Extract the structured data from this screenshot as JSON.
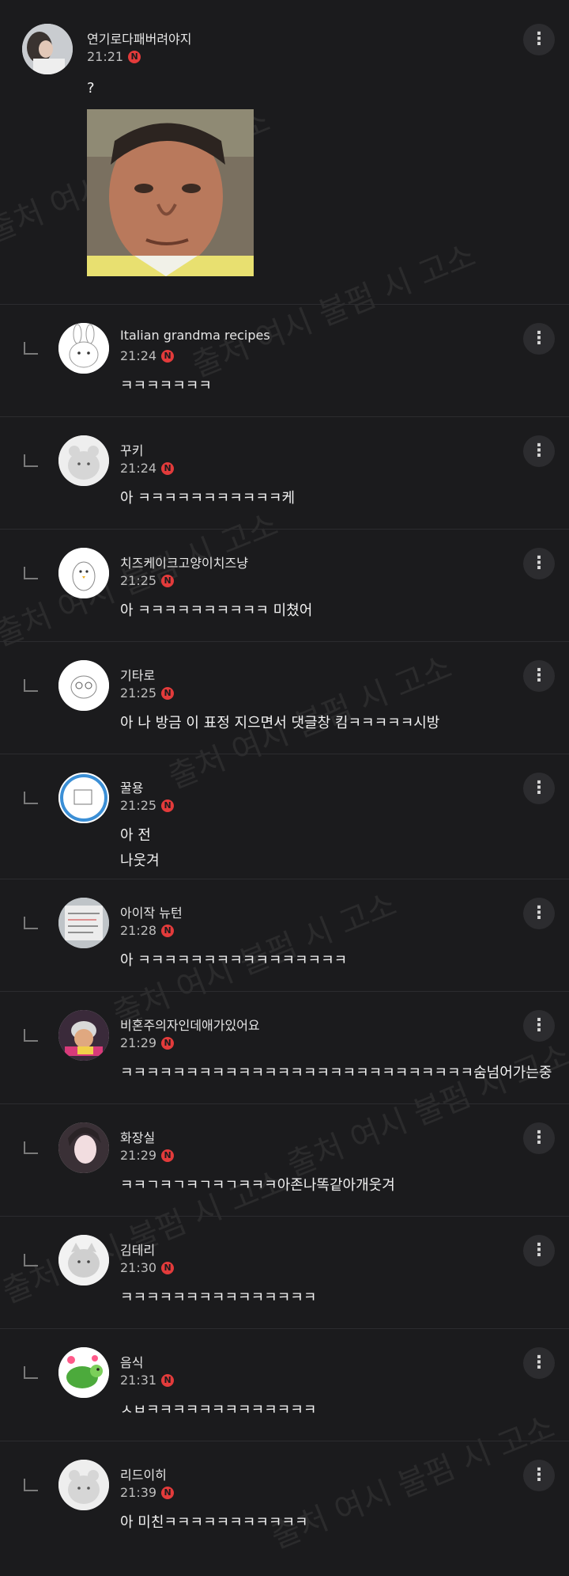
{
  "watermark": "출처 여시 불펌 시 고소",
  "top_comment": {
    "name": "연기로다패버려야지",
    "time": "21:21",
    "badge": "N",
    "text": "?"
  },
  "replies": [
    {
      "name": "Italian grandma recipes",
      "time": "21:24",
      "badge": "N",
      "text": "ㅋㅋㅋㅋㅋㅋㅋ",
      "avatar": "bunny-avatar"
    },
    {
      "name": "꾸키",
      "time": "21:24",
      "badge": "N",
      "text": "아 ㅋㅋㅋㅋㅋㅋㅋㅋㅋㅋㅋ케",
      "avatar": "bear-avatar"
    },
    {
      "name": "치즈케이크고양이치즈냥",
      "time": "21:25",
      "badge": "N",
      "text": "아 ㅋㅋㅋㅋㅋㅋㅋㅋㅋㅋ 미쳤어",
      "avatar": "penguin-avatar"
    },
    {
      "name": "기타로",
      "time": "21:25",
      "badge": "N",
      "text": "아 나 방금 이 표정 지으면서 댓글창 킴ㅋㅋㅋㅋㅋ시방",
      "avatar": "owl-avatar"
    },
    {
      "name": "꿀용",
      "time": "21:25",
      "badge": "N",
      "text": "아 전\n나웃겨",
      "avatar": "drawing-avatar"
    },
    {
      "name": "아이작 뉴턴",
      "time": "21:28",
      "badge": "N",
      "text": "아 ㅋㅋㅋㅋㅋㅋㅋㅋㅋㅋㅋㅋㅋㅋㅋㅋ",
      "avatar": "sign-avatar"
    },
    {
      "name": "비혼주의자인데애가있어요",
      "time": "21:29",
      "badge": "N",
      "text": "ㅋㅋㅋㅋㅋㅋㅋㅋㅋㅋㅋㅋㅋㅋㅋㅋㅋㅋㅋㅋㅋㅋㅋㅋㅋㅋㅋ숨넘어가는중",
      "avatar": "grandma-avatar"
    },
    {
      "name": "화장실",
      "time": "21:29",
      "badge": "N",
      "text": "ㅋㅋㄱㅋㄱㅋㄱㅋㄱㅋㅋㅋ아존나똑같아개웃겨",
      "avatar": "anime-avatar"
    },
    {
      "name": "김테리",
      "time": "21:30",
      "badge": "N",
      "text": "ㅋㅋㅋㅋㅋㅋㅋㅋㅋㅋㅋㅋㅋㅋㅋ",
      "avatar": "cat-avatar"
    },
    {
      "name": "음식",
      "time": "21:31",
      "badge": "N",
      "text": "ㅅㅂㅋㅋㅋㅋㅋㅋㅋㅋㅋㅋㅋㅋㅋ",
      "avatar": "turtle-avatar"
    },
    {
      "name": "리드이히",
      "time": "21:39",
      "badge": "N",
      "text": "아 미친ㅋㅋㅋㅋㅋㅋㅋㅋㅋㅋㅋ",
      "avatar": "bear-avatar"
    }
  ],
  "menu_icon": "more-vertical-icon",
  "colors": {
    "background": "#1b1b1d",
    "badge": "#e33b3b",
    "divider": "#2c2c2f"
  }
}
